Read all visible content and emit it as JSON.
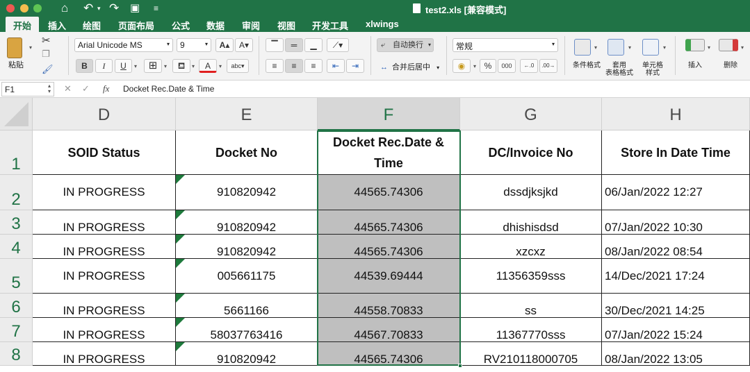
{
  "window": {
    "title": "test2.xls [兼容模式]"
  },
  "ribbon": {
    "tabs": [
      "开始",
      "插入",
      "绘图",
      "页面布局",
      "公式",
      "数据",
      "审阅",
      "视图",
      "开发工具",
      "xlwings"
    ],
    "active_tab": "开始"
  },
  "toolbar": {
    "paste_label": "粘贴",
    "font_name": "Arial Unicode MS",
    "font_size": "9",
    "bold": "B",
    "italic": "I",
    "underline": "U",
    "wrap_text": "自动换行",
    "merge_center": "合并后居中",
    "number_format": "常规",
    "percent": "%",
    "thousands": "000",
    "conditional_format": "条件格式",
    "format_table": "套用\n表格格式",
    "cell_style": "单元格\n样式",
    "insert": "插入",
    "delete": "删除",
    "increase_font": "A",
    "decrease_font": "A",
    "font_color_glyph": "A"
  },
  "formula_bar": {
    "name_box": "F1",
    "fx_label": "fx",
    "formula": "Docket Rec.Date & Time"
  },
  "sheet": {
    "columns": [
      "D",
      "E",
      "F",
      "G",
      "H"
    ],
    "selected_column": "F",
    "row_numbers": [
      "1",
      "2",
      "3",
      "4",
      "5",
      "6",
      "7",
      "8"
    ],
    "header_row": [
      "SOID Status",
      "Docket No",
      "Docket Rec.Date & Time",
      "DC/Invoice No",
      "Store In Date Time"
    ],
    "rows": [
      [
        "IN PROGRESS",
        "910820942",
        "44565.74306",
        "dssdjksjkd",
        "06/Jan/2022 12:27"
      ],
      [
        "IN PROGRESS",
        "910820942",
        "44565.74306",
        "dhishisdsd",
        "07/Jan/2022 10:30"
      ],
      [
        "IN PROGRESS",
        "910820942",
        "44565.74306",
        "xzcxz",
        "08/Jan/2022 08:54"
      ],
      [
        "IN PROGRESS",
        "005661175",
        "44539.69444",
        "11356359sss",
        "14/Dec/2021 17:24"
      ],
      [
        "IN PROGRESS",
        "5661166",
        "44558.70833",
        "ss",
        "30/Dec/2021 14:25"
      ],
      [
        "IN PROGRESS",
        "58037763416",
        "44567.70833",
        "11367770sss",
        "07/Jan/2022 15:24"
      ],
      [
        "IN PROGRESS",
        "910820942",
        "44565.74306",
        "RV210118000705",
        "08/Jan/2022 13:05"
      ]
    ]
  },
  "colors": {
    "brand_green": "#207346",
    "selection_fill": "#bfbfbf",
    "error_indicator": "#1e7a3c"
  }
}
